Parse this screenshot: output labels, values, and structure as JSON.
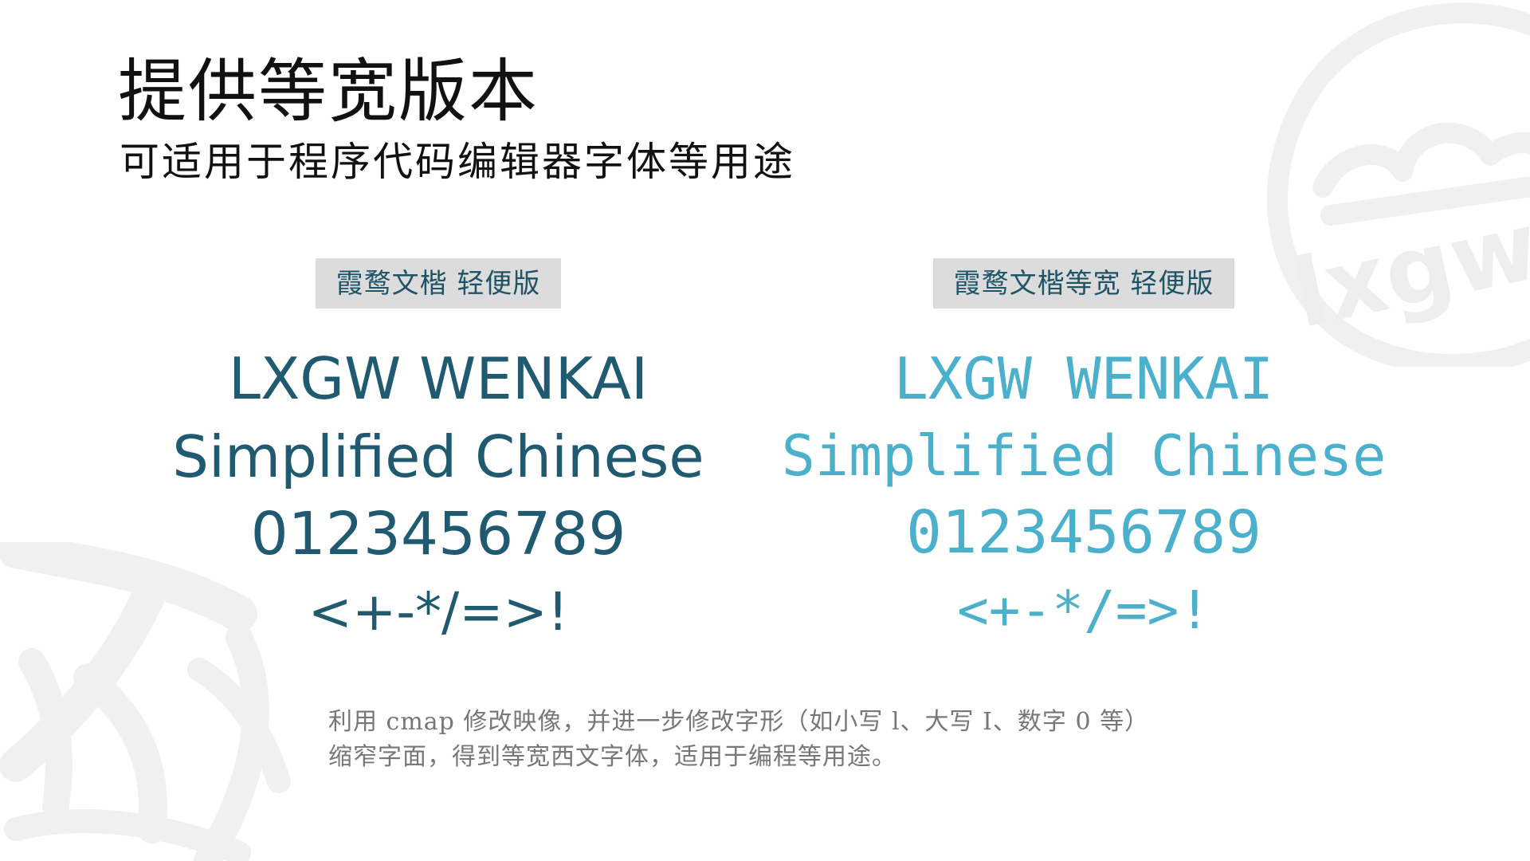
{
  "colors": {
    "sample_left": "#1f5a70",
    "sample_right": "#4ab0cc",
    "tag_bg": "#dcdcdc",
    "tag_text": "#1f5366",
    "watermark": "#f0f0f0"
  },
  "heading": {
    "title": "提供等宽版本",
    "subtitle": "可适用于程序代码编辑器字体等用途"
  },
  "left_sample": {
    "tag": "霞鹜文楷 轻便版",
    "lines": [
      "LXGW WENKAI",
      "Simplified Chinese",
      "0123456789",
      "<+-*/=>!"
    ]
  },
  "right_sample": {
    "tag": "霞鹜文楷等宽 轻便版",
    "lines": [
      "LXGW WENKAI",
      "Simplified Chinese",
      "0123456789",
      "<+-*/=>!"
    ]
  },
  "description": {
    "line1": "利用 cmap 修改映像，并进一步修改字形（如小写 l、大写 I、数字 0 等）",
    "line2": "缩窄字面，得到等宽西文字体，适用于编程等用途。"
  },
  "watermark": {
    "logo_text": "lxgw."
  }
}
